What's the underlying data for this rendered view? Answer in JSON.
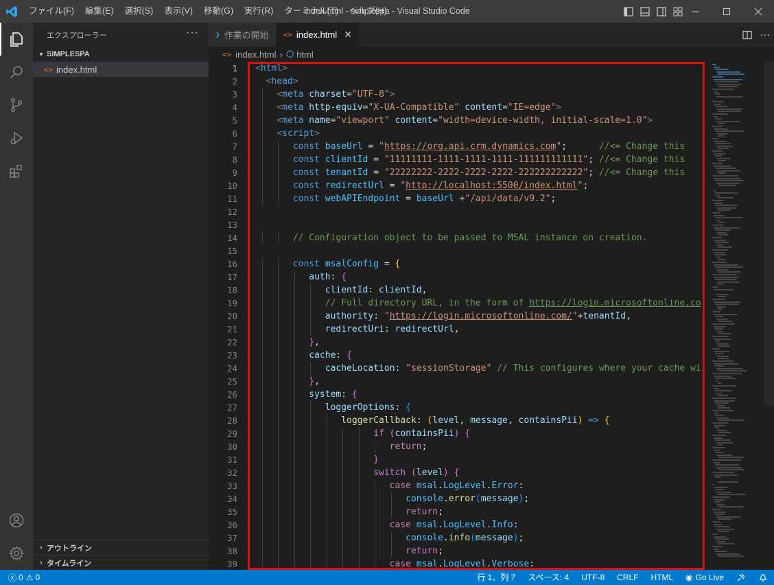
{
  "window": {
    "title": "index.html - simplespa - Visual Studio Code",
    "menu": [
      "ファイル(F)",
      "編集(E)",
      "選択(S)",
      "表示(V)",
      "移動(G)",
      "実行(R)",
      "ターミナル(T)",
      "ヘルプ(H)"
    ]
  },
  "activity_bar": {
    "top_icons": [
      "explorer-icon",
      "search-icon",
      "source-control-icon",
      "run-debug-icon",
      "extensions-icon"
    ],
    "bottom_icons": [
      "account-icon",
      "manage-gear-icon"
    ]
  },
  "sidebar": {
    "title": "エクスプローラー",
    "more": "···",
    "folder": "SIMPLESPA",
    "file": "index.html",
    "panels": [
      "アウトライン",
      "タイムライン"
    ]
  },
  "tabs": [
    {
      "label": "作業の開始",
      "active": false
    },
    {
      "label": "index.html",
      "active": true
    }
  ],
  "breadcrumb": {
    "file": "index.html",
    "symbol": "html"
  },
  "editor": {
    "current_line": 1,
    "lines": [
      [
        [
          "t-br",
          "<"
        ],
        [
          "t-tag",
          "html"
        ],
        [
          "t-br",
          ">"
        ]
      ],
      [
        [
          "",
          "  "
        ],
        [
          "t-br",
          "<"
        ],
        [
          "t-tag",
          "head"
        ],
        [
          "t-br",
          ">"
        ]
      ],
      [
        [
          "",
          "    "
        ],
        [
          "t-br",
          "<"
        ],
        [
          "t-tag",
          "meta"
        ],
        [
          "",
          " "
        ],
        [
          "t-attr",
          "charset"
        ],
        [
          "",
          "="
        ],
        [
          "t-str",
          "\"UTF-8\""
        ],
        [
          "t-br",
          ">"
        ]
      ],
      [
        [
          "",
          "    "
        ],
        [
          "t-br",
          "<"
        ],
        [
          "t-tag",
          "meta"
        ],
        [
          "",
          " "
        ],
        [
          "t-attr",
          "http-equiv"
        ],
        [
          "",
          "="
        ],
        [
          "t-str",
          "\"X-UA-Compatible\""
        ],
        [
          "",
          " "
        ],
        [
          "t-attr",
          "content"
        ],
        [
          "",
          "="
        ],
        [
          "t-str",
          "\"IE=edge\""
        ],
        [
          "t-br",
          ">"
        ]
      ],
      [
        [
          "",
          "    "
        ],
        [
          "t-br",
          "<"
        ],
        [
          "t-tag",
          "meta"
        ],
        [
          "",
          " "
        ],
        [
          "t-attr",
          "name"
        ],
        [
          "",
          "="
        ],
        [
          "t-str",
          "\"viewport\""
        ],
        [
          "",
          " "
        ],
        [
          "t-attr",
          "content"
        ],
        [
          "",
          "="
        ],
        [
          "t-str",
          "\"width=device-width, initial-scale=1.0\""
        ],
        [
          "t-br",
          ">"
        ]
      ],
      [
        [
          "",
          "    "
        ],
        [
          "t-br",
          "<"
        ],
        [
          "t-tag",
          "script"
        ],
        [
          "t-br",
          ">"
        ]
      ],
      [
        [
          "",
          "       "
        ],
        [
          "t-kw",
          "const"
        ],
        [
          "",
          " "
        ],
        [
          "t-var",
          "baseUrl"
        ],
        [
          "",
          " = "
        ],
        [
          "t-str",
          "\""
        ],
        [
          "t-str t-url",
          "https://org.api.crm.dynamics.com"
        ],
        [
          "t-str",
          "\""
        ],
        [
          "",
          ";      "
        ],
        [
          "t-com",
          "//<= Change this"
        ]
      ],
      [
        [
          "",
          "       "
        ],
        [
          "t-kw",
          "const"
        ],
        [
          "",
          " "
        ],
        [
          "t-var",
          "clientId"
        ],
        [
          "",
          " = "
        ],
        [
          "t-str",
          "\"11111111-1111-1111-1111-111111111111\""
        ],
        [
          "",
          "; "
        ],
        [
          "t-com",
          "//<= Change this"
        ]
      ],
      [
        [
          "",
          "       "
        ],
        [
          "t-kw",
          "const"
        ],
        [
          "",
          " "
        ],
        [
          "t-var",
          "tenantId"
        ],
        [
          "",
          " = "
        ],
        [
          "t-str",
          "\"22222222-2222-2222-2222-222222222222\""
        ],
        [
          "",
          "; "
        ],
        [
          "t-com",
          "//<= Change this"
        ]
      ],
      [
        [
          "",
          "       "
        ],
        [
          "t-kw",
          "const"
        ],
        [
          "",
          " "
        ],
        [
          "t-var",
          "redirectUrl"
        ],
        [
          "",
          " = "
        ],
        [
          "t-str",
          "\""
        ],
        [
          "t-str t-url",
          "http://localhost:5500/index.html"
        ],
        [
          "t-str",
          "\""
        ],
        [
          "",
          ";"
        ]
      ],
      [
        [
          "",
          "       "
        ],
        [
          "t-kw",
          "const"
        ],
        [
          "",
          " "
        ],
        [
          "t-var",
          "webAPIEndpoint"
        ],
        [
          "",
          " = "
        ],
        [
          "t-var",
          "baseUrl"
        ],
        [
          "",
          " +"
        ],
        [
          "t-str",
          "\"/api/data/v9.2\""
        ],
        [
          "",
          ";"
        ]
      ],
      [],
      [],
      [
        [
          "",
          "       "
        ],
        [
          "t-com",
          "// Configuration object to be passed to MSAL instance on creation."
        ]
      ],
      [],
      [
        [
          "",
          "       "
        ],
        [
          "t-kw",
          "const"
        ],
        [
          "",
          " "
        ],
        [
          "t-var",
          "msalConfig"
        ],
        [
          "",
          " = "
        ],
        [
          "t-p1",
          "{"
        ]
      ],
      [
        [
          "",
          "          "
        ],
        [
          "t-prop",
          "auth"
        ],
        [
          "",
          ": "
        ],
        [
          "t-p2",
          "{"
        ]
      ],
      [
        [
          "",
          "             "
        ],
        [
          "t-prop",
          "clientId"
        ],
        [
          "",
          ": "
        ],
        [
          "t-prop",
          "clientId"
        ],
        [
          "",
          ","
        ]
      ],
      [
        [
          "",
          "             "
        ],
        [
          "t-com",
          "// Full directory URL, in the form of "
        ],
        [
          "t-com t-url",
          "https://login.microsoftonline.com/<"
        ]
      ],
      [
        [
          "",
          "             "
        ],
        [
          "t-prop",
          "authority"
        ],
        [
          "",
          ": "
        ],
        [
          "t-str",
          "\""
        ],
        [
          "t-str t-url",
          "https://login.microsoftonline.com/"
        ],
        [
          "t-str",
          "\""
        ],
        [
          "",
          "+"
        ],
        [
          "t-prop",
          "tenantId"
        ],
        [
          "",
          ","
        ]
      ],
      [
        [
          "",
          "             "
        ],
        [
          "t-prop",
          "redirectUri"
        ],
        [
          "",
          ": "
        ],
        [
          "t-prop",
          "redirectUrl"
        ],
        [
          "",
          ","
        ]
      ],
      [
        [
          "",
          "          "
        ],
        [
          "t-p2",
          "}"
        ],
        [
          "",
          ","
        ]
      ],
      [
        [
          "",
          "          "
        ],
        [
          "t-prop",
          "cache"
        ],
        [
          "",
          ": "
        ],
        [
          "t-p2",
          "{"
        ]
      ],
      [
        [
          "",
          "             "
        ],
        [
          "t-prop",
          "cacheLocation"
        ],
        [
          "",
          ": "
        ],
        [
          "t-str",
          "\"sessionStorage\""
        ],
        [
          "",
          " "
        ],
        [
          "t-com",
          "// This configures where your cache will"
        ]
      ],
      [
        [
          "",
          "          "
        ],
        [
          "t-p2",
          "}"
        ],
        [
          "",
          ","
        ]
      ],
      [
        [
          "",
          "          "
        ],
        [
          "t-prop",
          "system"
        ],
        [
          "",
          ": "
        ],
        [
          "t-p2",
          "{"
        ]
      ],
      [
        [
          "",
          "             "
        ],
        [
          "t-prop",
          "loggerOptions"
        ],
        [
          "",
          ": "
        ],
        [
          "t-p3",
          "{"
        ]
      ],
      [
        [
          "",
          "                "
        ],
        [
          "t-fn",
          "loggerCallback"
        ],
        [
          "",
          ": "
        ],
        [
          "t-p1",
          "("
        ],
        [
          "t-prop",
          "level"
        ],
        [
          "",
          ", "
        ],
        [
          "t-prop",
          "message"
        ],
        [
          "",
          ", "
        ],
        [
          "t-prop",
          "containsPii"
        ],
        [
          "t-p1",
          ")"
        ],
        [
          "",
          " "
        ],
        [
          "t-kw",
          "=>"
        ],
        [
          "",
          " "
        ],
        [
          "t-p1",
          "{"
        ]
      ],
      [
        [
          "",
          "                      "
        ],
        [
          "t-ctl",
          "if"
        ],
        [
          "",
          " "
        ],
        [
          "t-p2",
          "("
        ],
        [
          "t-prop",
          "containsPii"
        ],
        [
          "t-p2",
          ")"
        ],
        [
          "",
          " "
        ],
        [
          "t-p2",
          "{"
        ]
      ],
      [
        [
          "",
          "                         "
        ],
        [
          "t-ctl",
          "return"
        ],
        [
          "",
          ";"
        ]
      ],
      [
        [
          "",
          "                      "
        ],
        [
          "t-p2",
          "}"
        ]
      ],
      [
        [
          "",
          "                      "
        ],
        [
          "t-ctl",
          "switch"
        ],
        [
          "",
          " "
        ],
        [
          "t-p2",
          "("
        ],
        [
          "t-prop",
          "level"
        ],
        [
          "t-p2",
          ")"
        ],
        [
          "",
          " "
        ],
        [
          "t-p2",
          "{"
        ]
      ],
      [
        [
          "",
          "                         "
        ],
        [
          "t-ctl",
          "case"
        ],
        [
          "",
          " "
        ],
        [
          "t-var",
          "msal"
        ],
        [
          "",
          "."
        ],
        [
          "t-var",
          "LogLevel"
        ],
        [
          "",
          "."
        ],
        [
          "t-var",
          "Error"
        ],
        [
          "",
          ":"
        ]
      ],
      [
        [
          "",
          "                            "
        ],
        [
          "t-var",
          "console"
        ],
        [
          "",
          "."
        ],
        [
          "t-fn",
          "error"
        ],
        [
          "t-p3",
          "("
        ],
        [
          "t-prop",
          "message"
        ],
        [
          "t-p3",
          ")"
        ],
        [
          "",
          ";"
        ]
      ],
      [
        [
          "",
          "                            "
        ],
        [
          "t-ctl",
          "return"
        ],
        [
          "",
          ";"
        ]
      ],
      [
        [
          "",
          "                         "
        ],
        [
          "t-ctl",
          "case"
        ],
        [
          "",
          " "
        ],
        [
          "t-var",
          "msal"
        ],
        [
          "",
          "."
        ],
        [
          "t-var",
          "LogLevel"
        ],
        [
          "",
          "."
        ],
        [
          "t-var",
          "Info"
        ],
        [
          "",
          ":"
        ]
      ],
      [
        [
          "",
          "                            "
        ],
        [
          "t-var",
          "console"
        ],
        [
          "",
          "."
        ],
        [
          "t-fn",
          "info"
        ],
        [
          "t-p3",
          "("
        ],
        [
          "t-prop",
          "message"
        ],
        [
          "t-p3",
          ")"
        ],
        [
          "",
          ";"
        ]
      ],
      [
        [
          "",
          "                            "
        ],
        [
          "t-ctl",
          "return"
        ],
        [
          "",
          ";"
        ]
      ],
      [
        [
          "",
          "                         "
        ],
        [
          "t-ctl",
          "case"
        ],
        [
          "",
          " "
        ],
        [
          "t-var",
          "msal"
        ],
        [
          "",
          "."
        ],
        [
          "t-var",
          "LogLevel"
        ],
        [
          "",
          "."
        ],
        [
          "t-var",
          "Verbose"
        ],
        [
          "",
          ":"
        ]
      ]
    ]
  },
  "status_bar": {
    "errors": "0",
    "warnings": "0",
    "position": "行 1、列 7",
    "spaces": "スペース: 4",
    "encoding": "UTF-8",
    "eol": "CRLF",
    "language": "HTML",
    "live": "Go Live"
  },
  "colors": {
    "accent": "#007acc",
    "highlight_box": "#e01010"
  }
}
